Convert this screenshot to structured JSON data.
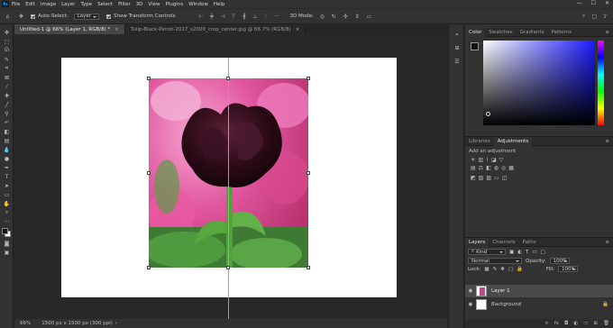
{
  "menubar": {
    "logo": "Ps",
    "items": [
      "File",
      "Edit",
      "Image",
      "Layer",
      "Type",
      "Select",
      "Filter",
      "3D",
      "View",
      "Plugins",
      "Window",
      "Help"
    ],
    "controls": {
      "minimize": "—",
      "maximize": "☐",
      "close": "✕"
    }
  },
  "options": {
    "auto_select_label": "Auto-Select:",
    "auto_select_value": "Layer",
    "transform_label": "Show Transform Controls",
    "mode_label": "3D Mode:"
  },
  "tabs": [
    {
      "label": "Untitled-1 @ 66% (Layer 1, RGB/8) *",
      "close": "×"
    },
    {
      "label": "Tulip-Black-Parrot-2017_s2000_crop_center.jpg @ 66.7% (RGB/8)",
      "close": "×"
    }
  ],
  "status": {
    "zoom": "66%",
    "info": "1500 px x 1500 px (300 ppi)"
  },
  "color_panel": {
    "tabs": [
      "Color",
      "Swatches",
      "Gradients",
      "Patterns"
    ],
    "colors": {
      "foreground": "#1a1a1a",
      "background": "#ffffff",
      "hue": "#1a1aff"
    }
  },
  "adjustments_panel": {
    "tabs": [
      "Libraries",
      "Adjustments"
    ],
    "hint": "Add an adjustment"
  },
  "layers_panel": {
    "tabs": [
      "Layers",
      "Channels",
      "Paths"
    ],
    "filter_label": "Kind",
    "blend_mode": "Normal",
    "opacity_label": "Opacity:",
    "opacity_value": "100%",
    "lock_label": "Lock:",
    "fill_label": "Fill:",
    "fill_value": "100%",
    "layers": [
      {
        "name": "Layer 1",
        "italic": false,
        "selected": true
      },
      {
        "name": "Background",
        "italic": true,
        "selected": false
      }
    ]
  }
}
